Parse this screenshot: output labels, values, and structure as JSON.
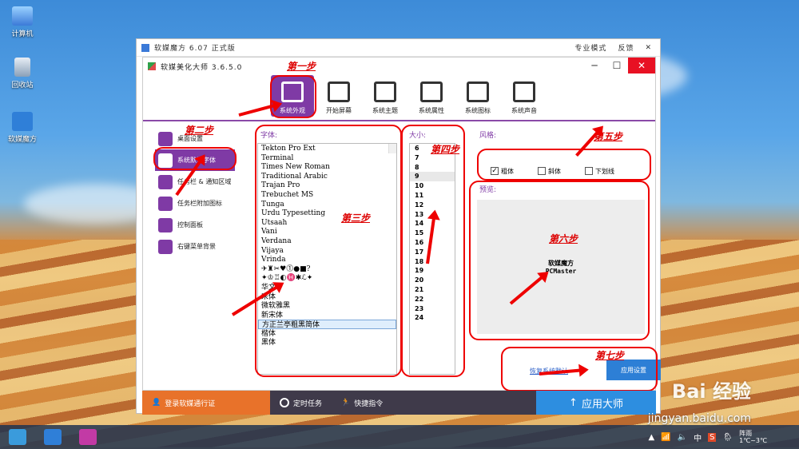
{
  "desktop": {
    "icons": [
      {
        "label": "计算机",
        "icon": "computer-icon"
      },
      {
        "label": "回收站",
        "icon": "recycle-bin-icon"
      },
      {
        "label": "软媒魔方",
        "icon": "ruanmei-cube-icon"
      }
    ]
  },
  "outer_window": {
    "title": "软媒魔方 6.07 正式版",
    "menu": [
      "专业模式",
      "反馈"
    ]
  },
  "inner_window": {
    "title": "软媒美化大师 3.6.5.0",
    "toolbar": [
      {
        "label": "系统外观",
        "icon": "brush-icon",
        "active": true
      },
      {
        "label": "开始屏幕",
        "icon": "start-screen-icon"
      },
      {
        "label": "系统主题",
        "icon": "tshirt-icon"
      },
      {
        "label": "系统属性",
        "icon": "oem-icon"
      },
      {
        "label": "系统图标",
        "icon": "star-icon"
      },
      {
        "label": "系统声音",
        "icon": "speaker-icon"
      }
    ],
    "sidebar": [
      {
        "label": "桌面设置"
      },
      {
        "label": "系统默认字体",
        "active": true
      },
      {
        "label": "任务栏 & 通知区域"
      },
      {
        "label": "任务栏附加图标"
      },
      {
        "label": "控制面板"
      },
      {
        "label": "右键菜单背景"
      }
    ],
    "font_label": "字体:",
    "fonts": [
      "Tekton Pro Ext",
      "Terminal",
      "Times New Roman",
      "Traditional Arabic",
      "Trajan Pro",
      "Trebuchet MS",
      "Tunga",
      "Urdu Typesetting",
      "Utsaah",
      "Vani",
      "Verdana",
      "Vijaya",
      "Vrinda",
      "✈♜✂♥⓵●■?",
      "✦♔♖◐♓✱ℒ✦",
      "华文",
      "宋体",
      "微软雅黑",
      "新宋体",
      "方正兰亭粗黑简体",
      "楷体",
      "黑体"
    ],
    "selected_font": "方正兰亭粗黑简体",
    "size_label": "大小:",
    "sizes": [
      "6",
      "7",
      "8",
      "9",
      "10",
      "11",
      "12",
      "13",
      "14",
      "15",
      "16",
      "17",
      "18",
      "19",
      "20",
      "21",
      "22",
      "23",
      "24"
    ],
    "selected_size": "9",
    "style_label": "风格:",
    "styles": [
      {
        "label": "粗体",
        "checked": true
      },
      {
        "label": "斜体",
        "checked": false
      },
      {
        "label": "下划线",
        "checked": false
      }
    ],
    "preview_label": "预览:",
    "preview_line1": "软媒魔方",
    "preview_line2": "PCMaster",
    "restore_link": "恢复系统默认",
    "apply_button": "应用设置"
  },
  "bottom_bar": {
    "login": "登录软媒通行证",
    "scheduled": "定时任务",
    "shortcut": "快捷指令",
    "apply_all": "应用大师"
  },
  "annotations": [
    "第一步",
    "第二步",
    "第三步",
    "第四步",
    "第五步",
    "第六步",
    "第七步"
  ],
  "taskbar": {
    "tray_ime": "中",
    "weather": "阵雨",
    "temp": "1℃~3℃"
  },
  "watermark": {
    "brand": "Bai 经验",
    "url": "jingyan.baidu.com"
  }
}
